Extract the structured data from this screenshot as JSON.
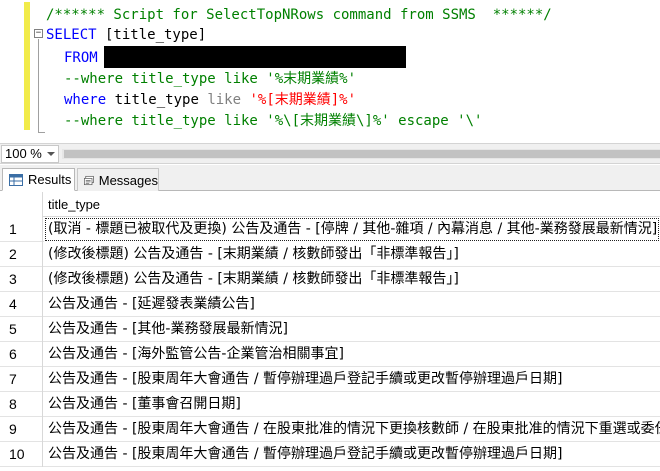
{
  "editor": {
    "lines": [
      {
        "text": "/****** Script for SelectTopNRows command from SSMS  ******/"
      },
      {
        "kw": "SELECT",
        "rest": " [title_type]"
      },
      {
        "kw": "FROM"
      },
      {
        "text": "--where title_type like '%末期業績%'"
      },
      {
        "kw": "where",
        "mid": " title_type ",
        "op": "like",
        "str": " '%[末期業績]%'"
      },
      {
        "text": "--where title_type like '%\\[末期業績\\]%' escape '\\'"
      }
    ]
  },
  "zoom": {
    "value": "100 %"
  },
  "tabs": {
    "results": "Results",
    "messages": "Messages"
  },
  "grid": {
    "column": "title_type",
    "rows": [
      {
        "num": "1",
        "value": "(取消 - 標題已被取代及更換) 公告及通告 - [停牌 / 其他-雜項 / 內幕消息 / 其他-業務發展最新情況]"
      },
      {
        "num": "2",
        "value": "(修改後標題) 公告及通告 - [末期業績 / 核數師發出「非標準報告」]"
      },
      {
        "num": "3",
        "value": "(修改後標題) 公告及通告 - [末期業績 / 核數師發出「非標準報告」]"
      },
      {
        "num": "4",
        "value": "公告及通告 - [延遲發表業績公告]"
      },
      {
        "num": "5",
        "value": "公告及通告 - [其他-業務發展最新情況]"
      },
      {
        "num": "6",
        "value": "公告及通告 - [海外監管公告-企業管治相關事宜]"
      },
      {
        "num": "7",
        "value": "公告及通告 - [股東周年大會通告 / 暫停辦理過戶登記手續或更改暫停辦理過戶日期]"
      },
      {
        "num": "8",
        "value": "公告及通告 - [董事會召開日期]"
      },
      {
        "num": "9",
        "value": "公告及通告 - [股東周年大會通告 / 在股東批准的情況下更換核數師 / 在股東批准的情況下重選或委任董事]"
      },
      {
        "num": "10",
        "value": "公告及通告 - [股東周年大會通告 / 暫停辦理過戶登記手續或更改暫停辦理過戶日期]"
      }
    ]
  }
}
